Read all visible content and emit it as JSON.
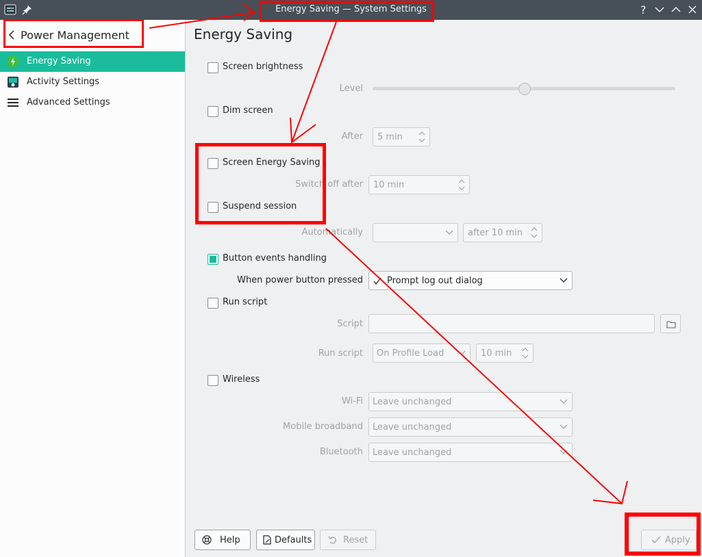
{
  "window": {
    "title": "Energy Saving — System Settings"
  },
  "sidebar": {
    "header": "Power Management",
    "items": [
      {
        "label": "Energy Saving",
        "icon": "energy-saving-icon",
        "active": true
      },
      {
        "label": "Activity Settings",
        "icon": "activity-settings-icon",
        "active": false
      },
      {
        "label": "Advanced Settings",
        "icon": "hamburger-menu-icon",
        "active": false
      }
    ]
  },
  "main": {
    "title": "Energy Saving",
    "screen_brightness": {
      "label": "Screen brightness",
      "checked": false,
      "level_label": "Level",
      "level_fraction": 0.5
    },
    "dim_screen": {
      "label": "Dim screen",
      "checked": false,
      "after_label": "After",
      "after_value": "5 min"
    },
    "screen_energy_saving": {
      "label": "Screen Energy Saving",
      "checked": false,
      "switch_off_label": "Switch off after",
      "switch_off_value": "10 min"
    },
    "suspend_session": {
      "label": "Suspend session",
      "checked": false,
      "automatically_label": "Automatically",
      "automatically_value": "",
      "after_value": "after 10 min"
    },
    "button_events": {
      "label": "Button events handling",
      "checked": true,
      "power_button_label": "When power button pressed",
      "power_button_value": "Prompt log out dialog"
    },
    "run_script": {
      "label": "Run script",
      "checked": false,
      "script_label": "Script",
      "script_value": "",
      "run_script_label": "Run script",
      "run_script_value": "On Profile Load",
      "run_script_time": "10 min"
    },
    "wireless": {
      "label": "Wireless",
      "checked": false,
      "wifi_label": "Wi-Fi",
      "wifi_value": "Leave unchanged",
      "mobile_label": "Mobile broadband",
      "mobile_value": "Leave unchanged",
      "bluetooth_label": "Bluetooth",
      "bluetooth_value": "Leave unchanged"
    }
  },
  "footer": {
    "help": "Help",
    "defaults": "Defaults",
    "reset": "Reset",
    "apply": "Apply"
  },
  "colors": {
    "accent": "#1abc9c",
    "titlebar": "#475057",
    "annotation": "#ff0000"
  }
}
